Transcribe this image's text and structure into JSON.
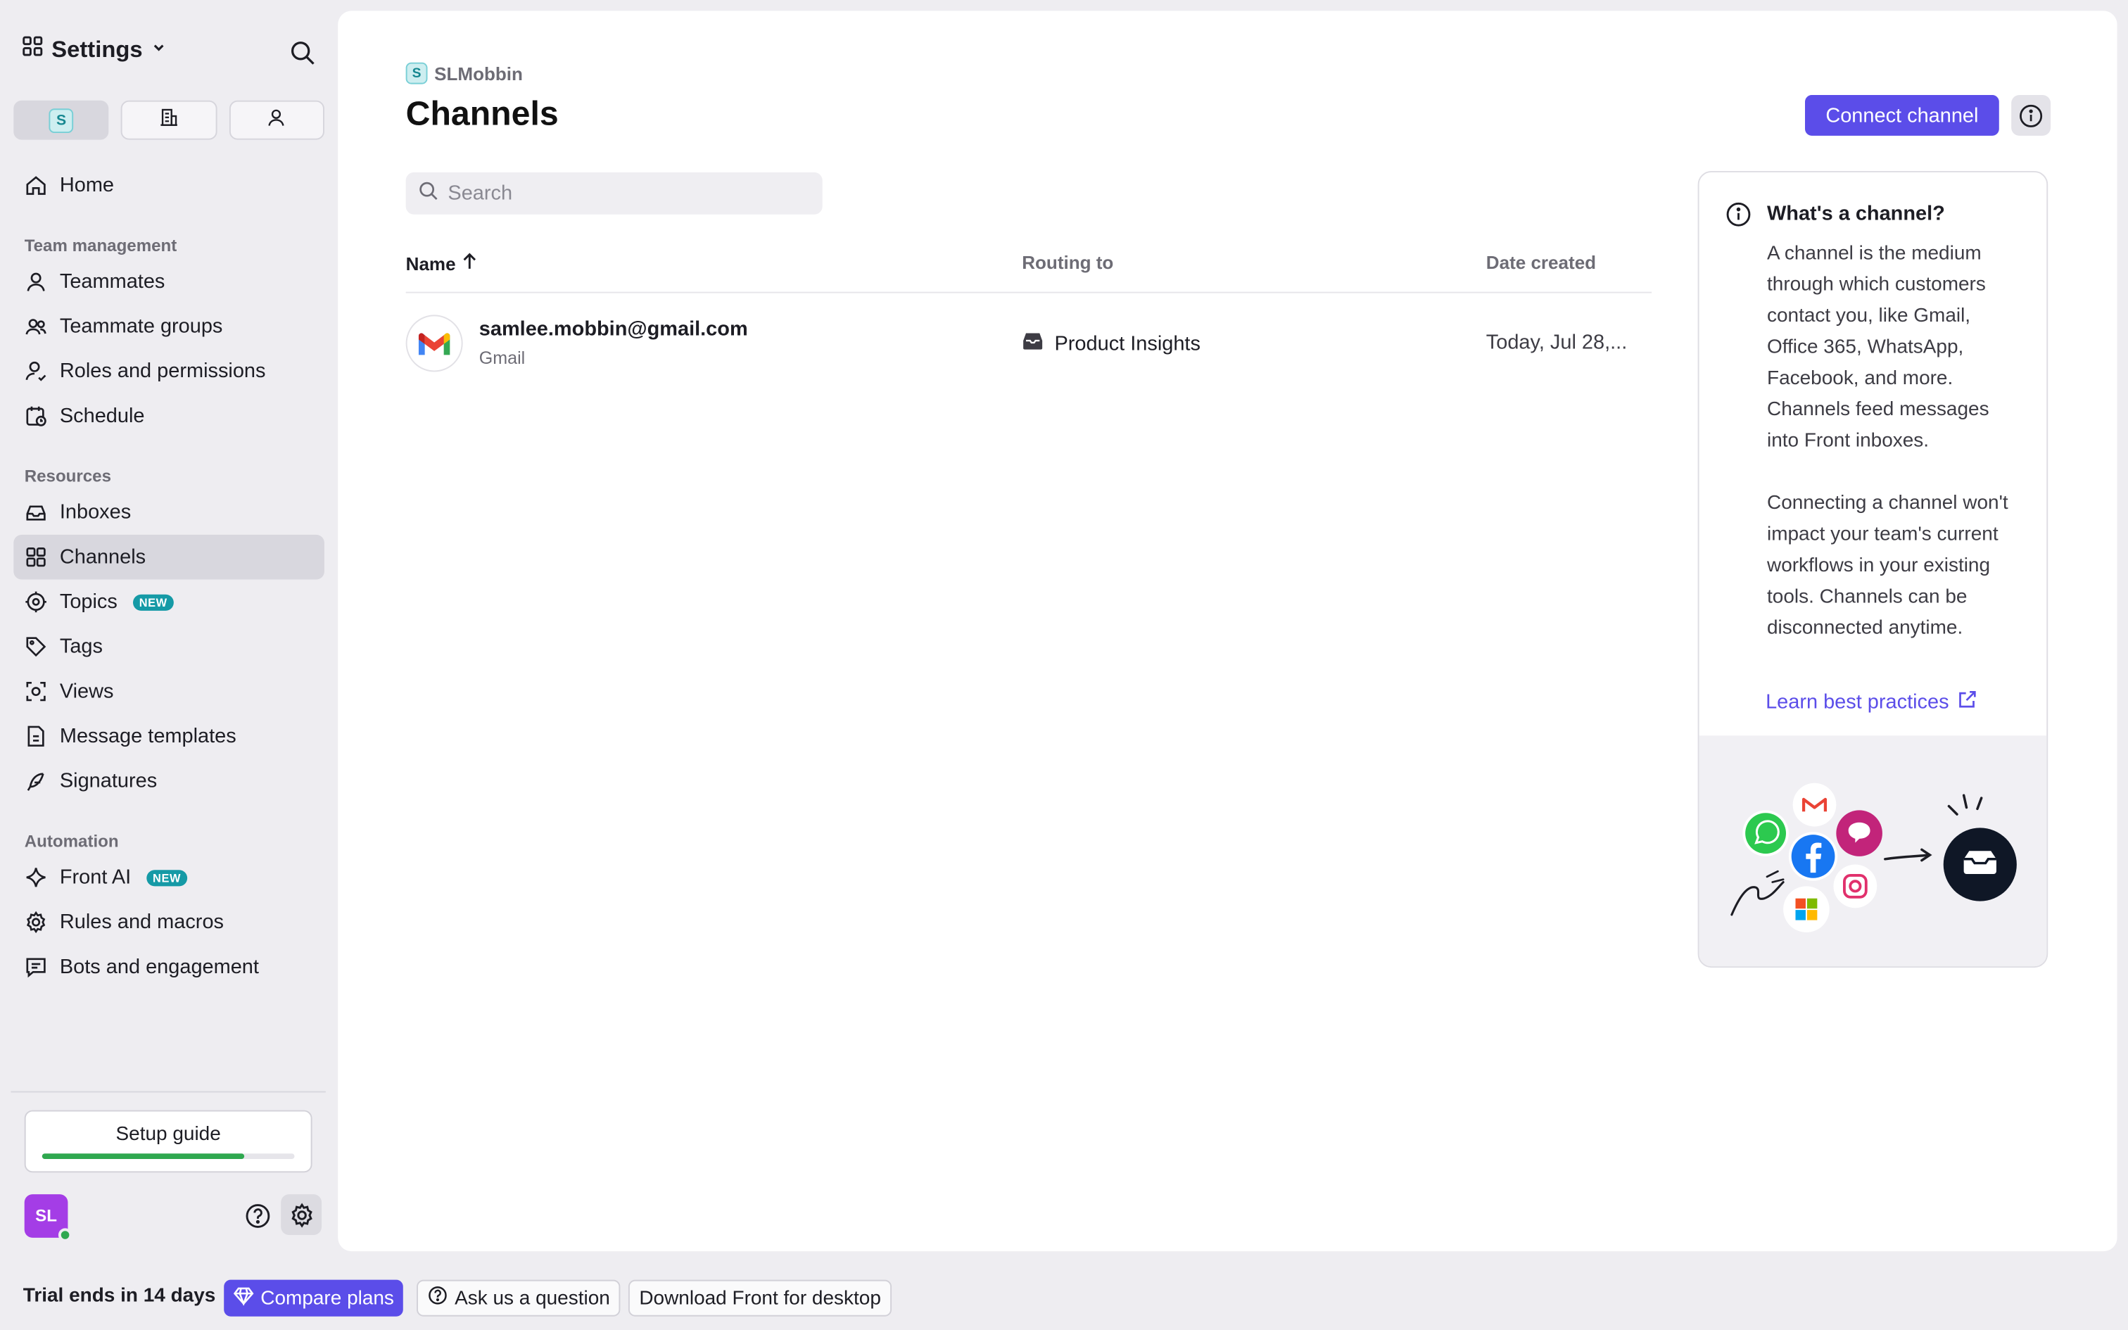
{
  "sidebar": {
    "title": "Settings",
    "workspace_badge": "S",
    "sections": {
      "team": "Team management",
      "resources": "Resources",
      "automation": "Automation"
    },
    "items": {
      "home": "Home",
      "teammates": "Teammates",
      "teammate_groups": "Teammate groups",
      "roles": "Roles and permissions",
      "schedule": "Schedule",
      "inboxes": "Inboxes",
      "channels": "Channels",
      "topics": "Topics",
      "tags": "Tags",
      "views": "Views",
      "message_templates": "Message templates",
      "signatures": "Signatures",
      "front_ai": "Front AI",
      "rules": "Rules and macros",
      "bots": "Bots and engagement"
    },
    "new_badge": "NEW",
    "setup_guide": {
      "label": "Setup guide",
      "progress": 0.8
    },
    "avatar_initials": "SL",
    "active_item": "channels"
  },
  "main": {
    "breadcrumb_badge": "S",
    "breadcrumb": "SLMobbin",
    "title": "Channels",
    "connect_button": "Connect channel",
    "search_placeholder": "Search",
    "table": {
      "columns": {
        "name": "Name",
        "routing": "Routing to",
        "date": "Date created"
      },
      "rows": [
        {
          "email": "samlee.mobbin@gmail.com",
          "type": "Gmail",
          "routing": "Product Insights",
          "date": "Today, Jul 28,..."
        }
      ]
    },
    "info_card": {
      "title": "What's a channel?",
      "paragraph1": "A channel is the medium through which customers contact you, like Gmail, Office 365, WhatsApp, Facebook, and more. Channels feed messages into Front inboxes.",
      "paragraph2": "Connecting a channel won't impact your team's current workflows in your existing tools. Channels can be disconnected anytime.",
      "link": "Learn best practices"
    }
  },
  "footer": {
    "trial": "Trial ends in 14 days",
    "compare": "Compare plans",
    "ask": "Ask us a question",
    "download": "Download Front for desktop"
  },
  "colors": {
    "accent": "#5b4de9",
    "active_nav": "#d8d7de",
    "new_badge": "#159aa6",
    "progress": "#2fa84f",
    "avatar": "#a43de6"
  }
}
